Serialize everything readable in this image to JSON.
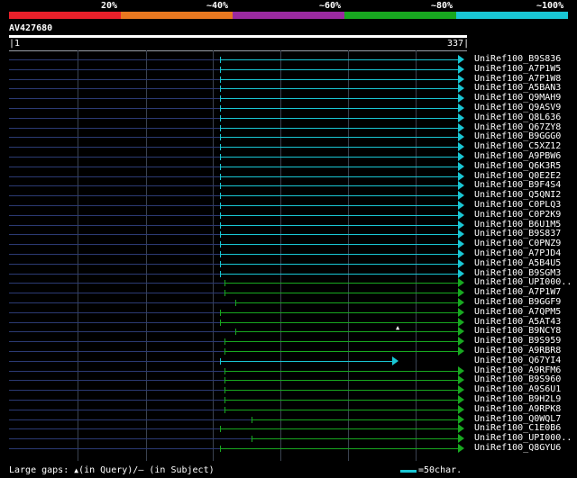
{
  "scale": {
    "labels": [
      "20%",
      "~40%",
      "~60%",
      "~80%",
      "~100%"
    ],
    "colors": [
      "#e8202a",
      "#e87820",
      "#9a2aa0",
      "#18a820",
      "#19c6d4"
    ]
  },
  "query": {
    "name": "AV427680",
    "start": "1",
    "end": "337"
  },
  "colors": {
    "cyan": "#19c6d4",
    "green": "#18a820",
    "query_line": "#2b3a73"
  },
  "hits": [
    {
      "name": "UniRef100_B9S836",
      "color": "cyan",
      "from": 0.46,
      "to": 0.995,
      "arrow": true
    },
    {
      "name": "UniRef100_A7P1W5",
      "color": "cyan",
      "from": 0.46,
      "to": 0.995,
      "arrow": true
    },
    {
      "name": "UniRef100_A7P1W8",
      "color": "cyan",
      "from": 0.46,
      "to": 0.995,
      "arrow": true
    },
    {
      "name": "UniRef100_A5BAN3",
      "color": "cyan",
      "from": 0.46,
      "to": 0.995,
      "arrow": true
    },
    {
      "name": "UniRef100_Q9MAH9",
      "color": "cyan",
      "from": 0.46,
      "to": 0.995,
      "arrow": true
    },
    {
      "name": "UniRef100_Q9ASV9",
      "color": "cyan",
      "from": 0.46,
      "to": 0.995,
      "arrow": true
    },
    {
      "name": "UniRef100_Q8L636",
      "color": "cyan",
      "from": 0.46,
      "to": 0.995,
      "arrow": true
    },
    {
      "name": "UniRef100_Q67ZY8",
      "color": "cyan",
      "from": 0.46,
      "to": 0.995,
      "arrow": true
    },
    {
      "name": "UniRef100_B9GGG0",
      "color": "cyan",
      "from": 0.46,
      "to": 0.995,
      "arrow": true
    },
    {
      "name": "UniRef100_C5XZ12",
      "color": "cyan",
      "from": 0.46,
      "to": 0.995,
      "arrow": true
    },
    {
      "name": "UniRef100_A9PBW6",
      "color": "cyan",
      "from": 0.46,
      "to": 0.995,
      "arrow": true
    },
    {
      "name": "UniRef100_Q6K3R5",
      "color": "cyan",
      "from": 0.46,
      "to": 0.995,
      "arrow": true
    },
    {
      "name": "UniRef100_Q0E2E2",
      "color": "cyan",
      "from": 0.46,
      "to": 0.995,
      "arrow": true
    },
    {
      "name": "UniRef100_B9F4S4",
      "color": "cyan",
      "from": 0.46,
      "to": 0.995,
      "arrow": true
    },
    {
      "name": "UniRef100_Q5QNI2",
      "color": "cyan",
      "from": 0.46,
      "to": 0.995,
      "arrow": true
    },
    {
      "name": "UniRef100_C0PLQ3",
      "color": "cyan",
      "from": 0.46,
      "to": 0.995,
      "arrow": true
    },
    {
      "name": "UniRef100_C0P2K9",
      "color": "cyan",
      "from": 0.46,
      "to": 0.995,
      "arrow": true
    },
    {
      "name": "UniRef100_B6U1M5",
      "color": "cyan",
      "from": 0.46,
      "to": 0.995,
      "arrow": true
    },
    {
      "name": "UniRef100_B9S837",
      "color": "cyan",
      "from": 0.46,
      "to": 0.995,
      "arrow": true
    },
    {
      "name": "UniRef100_C0PNZ9",
      "color": "cyan",
      "from": 0.46,
      "to": 0.995,
      "arrow": true
    },
    {
      "name": "UniRef100_A7PJD4",
      "color": "cyan",
      "from": 0.46,
      "to": 0.995,
      "arrow": true
    },
    {
      "name": "UniRef100_A5B4U5",
      "color": "cyan",
      "from": 0.46,
      "to": 0.995,
      "arrow": true
    },
    {
      "name": "UniRef100_B9SGM3",
      "color": "cyan",
      "from": 0.46,
      "to": 0.995,
      "arrow": true
    },
    {
      "name": "UniRef100_UPI000..",
      "color": "green",
      "from": 0.47,
      "to": 0.995,
      "arrow": true
    },
    {
      "name": "UniRef100_A7P1W7",
      "color": "green",
      "from": 0.47,
      "to": 0.995,
      "arrow": true
    },
    {
      "name": "UniRef100_B9GGF9",
      "color": "green",
      "from": 0.495,
      "to": 0.995,
      "arrow": true
    },
    {
      "name": "UniRef100_A7QPM5",
      "color": "green",
      "from": 0.46,
      "to": 0.995,
      "arrow": true
    },
    {
      "name": "UniRef100_A5AT43",
      "color": "green",
      "from": 0.46,
      "to": 0.995,
      "arrow": true
    },
    {
      "name": "UniRef100_B9NCY8",
      "color": "green",
      "from": 0.495,
      "to": 0.995,
      "arrow": true,
      "gap": 0.845
    },
    {
      "name": "UniRef100_B9S959",
      "color": "green",
      "from": 0.47,
      "to": 0.995,
      "arrow": true
    },
    {
      "name": "UniRef100_A9RBR8",
      "color": "green",
      "from": 0.47,
      "to": 0.995,
      "arrow": true
    },
    {
      "name": "UniRef100_Q67YI4",
      "color": "cyan",
      "from": 0.46,
      "to": 0.85,
      "arrow": true
    },
    {
      "name": "UniRef100_A9RFM6",
      "color": "green",
      "from": 0.47,
      "to": 0.995,
      "arrow": true
    },
    {
      "name": "UniRef100_B9S960",
      "color": "green",
      "from": 0.47,
      "to": 0.995,
      "arrow": true
    },
    {
      "name": "UniRef100_A9S6U1",
      "color": "green",
      "from": 0.47,
      "to": 0.995,
      "arrow": true
    },
    {
      "name": "UniRef100_B9H2L9",
      "color": "green",
      "from": 0.47,
      "to": 0.995,
      "arrow": true
    },
    {
      "name": "UniRef100_A9RPK8",
      "color": "green",
      "from": 0.47,
      "to": 0.995,
      "arrow": true
    },
    {
      "name": "UniRef100_Q0WQL7",
      "color": "green",
      "from": 0.53,
      "to": 0.995,
      "arrow": true
    },
    {
      "name": "UniRef100_C1E0B6",
      "color": "green",
      "from": 0.46,
      "to": 0.995,
      "arrow": true
    },
    {
      "name": "UniRef100_UPI000..",
      "color": "green",
      "from": 0.53,
      "to": 0.995,
      "arrow": true
    },
    {
      "name": "UniRef100_Q8GYU6",
      "color": "green",
      "from": 0.46,
      "to": 0.995,
      "arrow": true
    }
  ],
  "footer": {
    "large_gaps_prefix": "Large gaps: ",
    "query_marker": "▲",
    "query_text": "(in Query)/",
    "subject_marker": "—",
    "subject_text": " (in Subject)",
    "legend_text": "=50char."
  }
}
